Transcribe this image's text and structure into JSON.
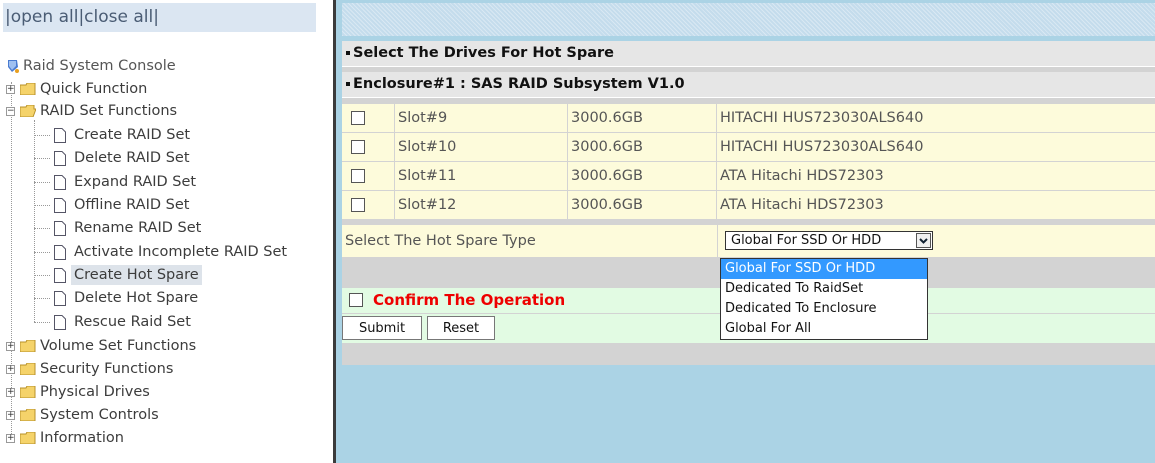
{
  "nav": {
    "open_all": "open all",
    "close_all": "close all",
    "root": "Raid System Console",
    "items": [
      {
        "label": "Quick Function"
      },
      {
        "label": "RAID Set Functions",
        "children": [
          {
            "label": "Create RAID Set"
          },
          {
            "label": "Delete RAID Set"
          },
          {
            "label": "Expand RAID Set"
          },
          {
            "label": "Offline RAID Set"
          },
          {
            "label": "Rename RAID Set"
          },
          {
            "label": "Activate Incomplete RAID Set"
          },
          {
            "label": "Create Hot Spare",
            "selected": true
          },
          {
            "label": "Delete Hot Spare"
          },
          {
            "label": "Rescue Raid Set"
          }
        ]
      },
      {
        "label": "Volume Set Functions"
      },
      {
        "label": "Security Functions"
      },
      {
        "label": "Physical Drives"
      },
      {
        "label": "System Controls"
      },
      {
        "label": "Information"
      }
    ]
  },
  "main": {
    "title": "Select The Drives For Hot Spare",
    "enclosure": "Enclosure#1 : SAS RAID Subsystem V1.0",
    "drives": [
      {
        "slot": "Slot#9",
        "capacity": "3000.6GB",
        "model": "HITACHI HUS723030ALS640",
        "checked": false
      },
      {
        "slot": "Slot#10",
        "capacity": "3000.6GB",
        "model": "HITACHI HUS723030ALS640",
        "checked": false
      },
      {
        "slot": "Slot#11",
        "capacity": "3000.6GB",
        "model": "ATA Hitachi HDS72303",
        "checked": false
      },
      {
        "slot": "Slot#12",
        "capacity": "3000.6GB",
        "model": "ATA Hitachi HDS72303",
        "checked": false
      }
    ],
    "hot_spare_type_label": "Select The Hot Spare Type",
    "hot_spare_type_value": "Global For SSD Or HDD",
    "hot_spare_options": [
      "Global For SSD Or HDD",
      "Dedicated To RaidSet",
      "Dedicated To Enclosure",
      "Global For All"
    ],
    "confirm_label": "Confirm The Operation",
    "submit_label": "Submit",
    "reset_label": "Reset"
  },
  "colors": {
    "confirm_text": "#e00000",
    "row_bg": "#fdfbdb",
    "confirm_bg": "#e2fbe3",
    "right_bg": "#abd3e5",
    "selected_option": "#3399ff"
  },
  "icons": {
    "root": "raid-console-icon",
    "folder": "folder-icon",
    "page": "page-icon",
    "expander": "plus-minus-expander-icon",
    "dropdown": "chevron-down-icon"
  }
}
